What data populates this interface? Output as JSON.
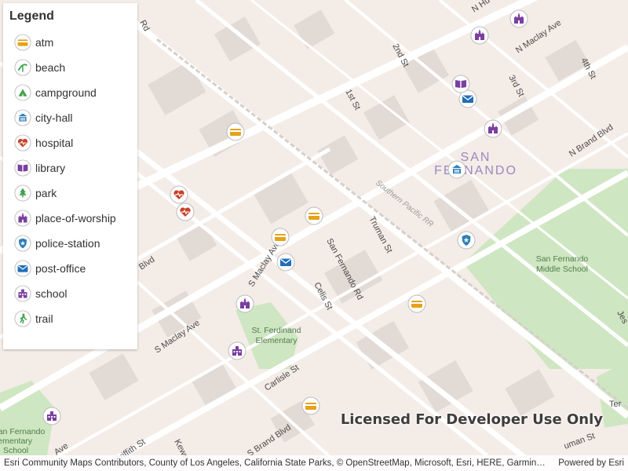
{
  "legend": {
    "title": "Legend",
    "items": [
      {
        "label": "atm",
        "icon": "atm-icon",
        "color": "#e6a21a"
      },
      {
        "label": "beach",
        "icon": "beach-icon",
        "color": "#3fa34d"
      },
      {
        "label": "campground",
        "icon": "campground-icon",
        "color": "#3fa34d"
      },
      {
        "label": "city-hall",
        "icon": "city-hall-icon",
        "color": "#2f7fb8"
      },
      {
        "label": "hospital",
        "icon": "hospital-icon",
        "color": "#c8412a"
      },
      {
        "label": "library",
        "icon": "library-icon",
        "color": "#7b3fa0"
      },
      {
        "label": "park",
        "icon": "park-icon",
        "color": "#3fa34d"
      },
      {
        "label": "place-of-worship",
        "icon": "place-of-worship-icon",
        "color": "#7b3fa0"
      },
      {
        "label": "police-station",
        "icon": "police-station-icon",
        "color": "#2f7fb8"
      },
      {
        "label": "post-office",
        "icon": "post-office-icon",
        "color": "#1f6fb8"
      },
      {
        "label": "school",
        "icon": "school-icon",
        "color": "#7b3fa0"
      },
      {
        "label": "trail",
        "icon": "trail-icon",
        "color": "#3fa34d"
      }
    ]
  },
  "map": {
    "place_label": [
      "SAN",
      "FERNANDO"
    ],
    "streets": [
      "N Maclay Ave",
      "2nd St",
      "1st St",
      "3rd St",
      "4th St",
      "N Brand Blvd",
      "Southern Pacific RR",
      "Truman St",
      "San Fernando Rd",
      "S Maclay Ave",
      "Celis St",
      "Carlisle St",
      "S Brand Blvd",
      "Griffith St",
      "Blvd",
      "N Hu",
      "Rd",
      "Keweı",
      "Ave",
      "uman St",
      "Jes",
      "Ter"
    ],
    "poi_labels": {
      "middle_school": [
        "San Fernando",
        "Middle School"
      ],
      "elementary": [
        "St. Ferdinand",
        "Elementary"
      ],
      "sw_school": [
        "San Fernando",
        "lementary",
        "School"
      ]
    }
  },
  "watermark": "Licensed For Developer Use Only",
  "attribution": {
    "sources": "Esri Community Maps Contributors, County of Los Angeles, California State Parks, © OpenStreetMap, Microsoft, Esri, HERE, Garmin, ...",
    "powered_by": "Powered by Esri"
  }
}
